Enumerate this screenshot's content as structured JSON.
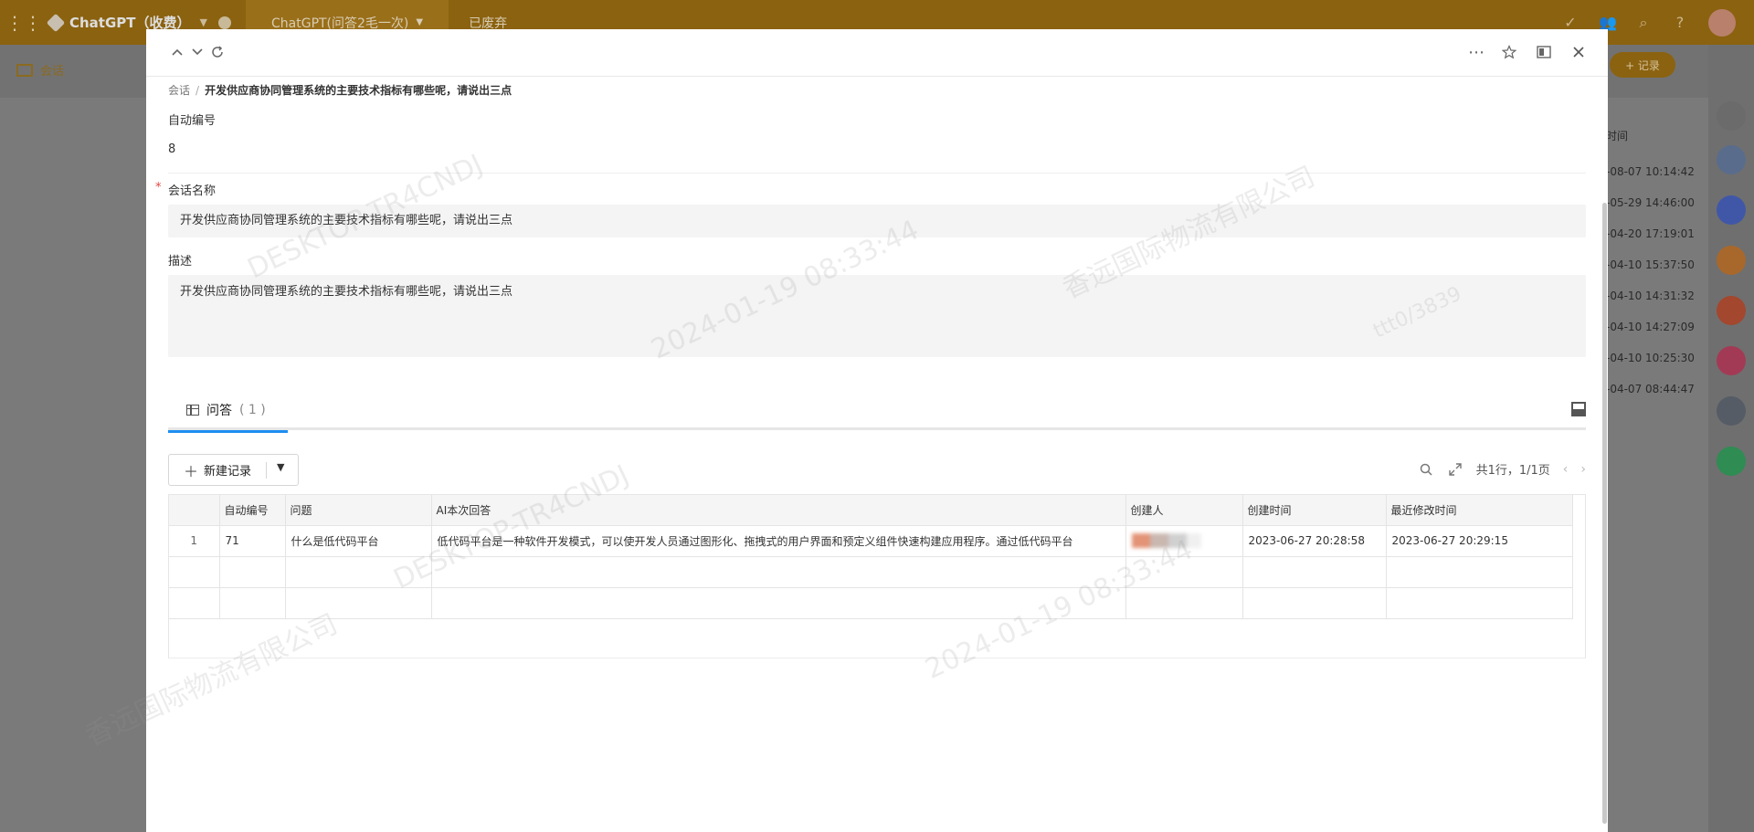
{
  "background_app": {
    "app_name": "ChatGPT（收费）",
    "tab_active": "ChatGPT(问答2毛一次)",
    "tab_other": "已废弃",
    "session_label": "会话",
    "add_record": "+ 记录",
    "list_header": "时间",
    "times": [
      "-08-07 10:14:42",
      "-05-29 14:46:00",
      "-04-20 17:19:01",
      "-04-10 15:37:50",
      "-04-10 14:31:32",
      "-04-10 14:27:09",
      "-04-10 10:25:30",
      "-04-07 08:44:47"
    ]
  },
  "modal": {
    "breadcrumb": {
      "parent": "会话",
      "separator": "/",
      "current": "开发供应商协同管理系统的主要技术指标有哪些呢，请说出三点"
    },
    "fields": {
      "auto_no": {
        "label": "自动编号",
        "value": "8"
      },
      "session_name": {
        "required_mark": "*",
        "label": "会话名称",
        "value": "开发供应商协同管理系统的主要技术指标有哪些呢，请说出三点"
      },
      "description": {
        "label": "描述",
        "value": "开发供应商协同管理系统的主要技术指标有哪些呢，请说出三点"
      }
    },
    "tab": {
      "label": "问答",
      "count": "( 1 )"
    },
    "toolbar": {
      "new_record": "新建记录",
      "pager_summary": "共1行，1/1页"
    },
    "table": {
      "columns": [
        "",
        "自动编号",
        "问题",
        "AI本次回答",
        "创建人",
        "创建时间",
        "最近修改时间"
      ],
      "rows": [
        {
          "index": "1",
          "auto_no": "71",
          "question": "什么是低代码平台",
          "answer": "低代码平台是一种软件开发模式，可以使开发人员通过图形化、拖拽式的用户界面和预定义组件快速构建应用程序。通过低代码平台",
          "creator": "",
          "created": "2023-06-27 20:28:58",
          "modified": "2023-06-27 20:29:15"
        }
      ]
    }
  },
  "watermark": {
    "host": "DESKTOP-TR4CNDJ",
    "datetime": "2024-01-19 08:33:44",
    "company": "香远国际物流有限公司",
    "code": "ttt0/3839"
  }
}
